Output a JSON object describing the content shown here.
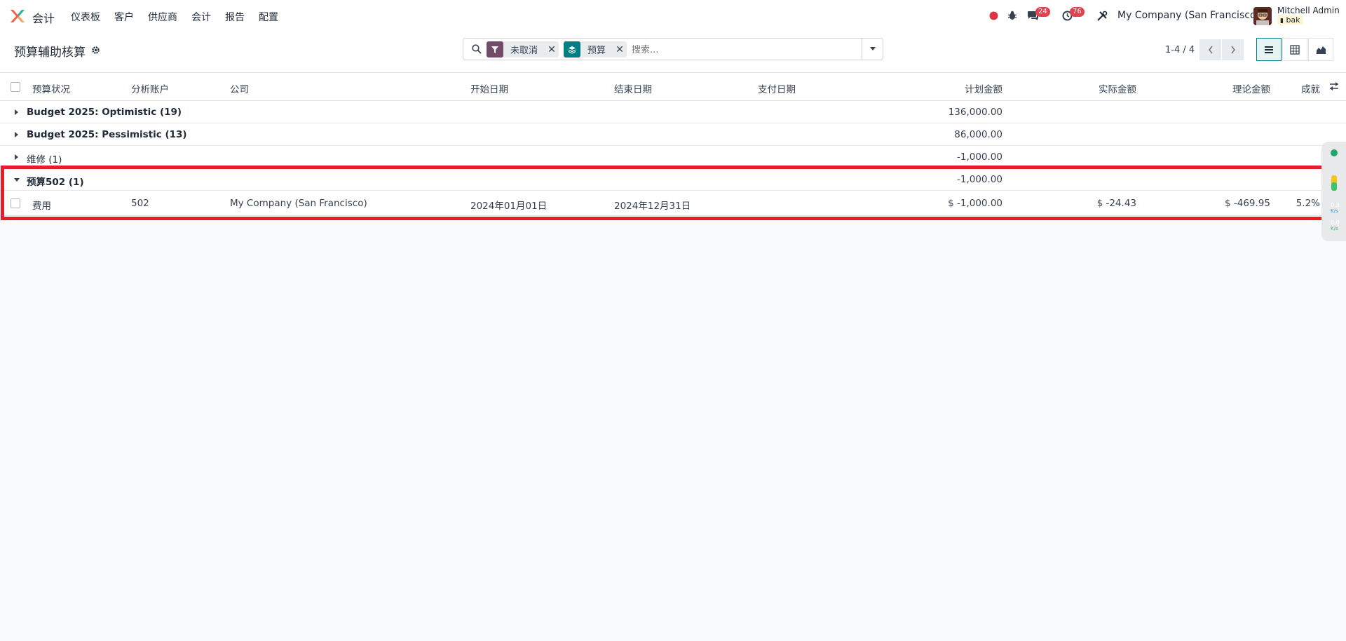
{
  "navbar": {
    "app_name": "会计",
    "menu": [
      "仪表板",
      "客户",
      "供应商",
      "会计",
      "报告",
      "配置"
    ],
    "messages_count": "24",
    "activities_count": "76",
    "company": "My Company (San Francisco)",
    "user_name": "Mitchell Admin",
    "db_name": "bak"
  },
  "control": {
    "title": "预算辅助核算",
    "facets": [
      {
        "label": "未取消",
        "color": "#714b67",
        "icon": "filter-icon"
      },
      {
        "label": "预算",
        "color": "#017e84",
        "icon": "layers-icon"
      }
    ],
    "search_placeholder": "搜索...",
    "pager": "1-4 / 4"
  },
  "table": {
    "headers": {
      "status": "预算状况",
      "analytic": "分析账户",
      "company": "公司",
      "start": "开始日期",
      "end": "结束日期",
      "paid": "支付日期",
      "planned": "计划金额",
      "practical": "实际金额",
      "theoretical": "理论金额",
      "achievement": "成就"
    },
    "groups": [
      {
        "name": "Budget 2025: Optimistic (19)",
        "planned": "136,000.00",
        "open": false
      },
      {
        "name": "Budget 2025: Pessimistic (13)",
        "planned": "86,000.00",
        "open": false
      },
      {
        "name": "维修 (1)",
        "planned": "-1,000.00",
        "open": false
      },
      {
        "name": "预算502 (1)",
        "planned": "-1,000.00",
        "open": true
      }
    ],
    "row": {
      "status": "费用",
      "analytic": "502",
      "company": "My Company (San Francisco)",
      "start": "2024年01月01日",
      "end": "2024年12月31日",
      "planned": "$ -1,000.00",
      "practical": "$ -24.43",
      "theoretical": "$ -469.95",
      "achievement": "5.2%"
    }
  },
  "side_widget": {
    "upload": "0.3",
    "upload_unit": "K/s",
    "download": "0.0",
    "download_unit": "K/s"
  },
  "colors": {
    "highlight": "#e51e2a",
    "badge": "#e3414e",
    "primary": "#714b67",
    "teal": "#017e84"
  }
}
